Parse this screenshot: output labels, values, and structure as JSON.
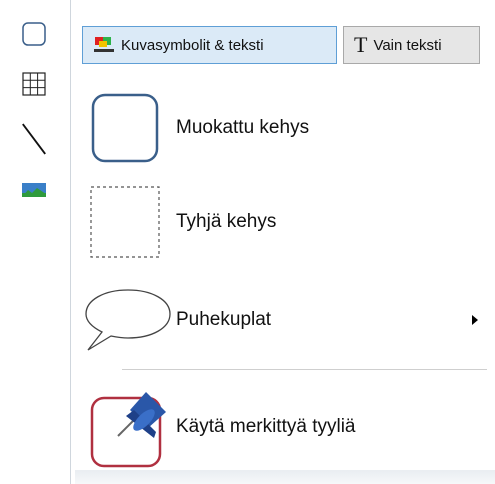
{
  "toolbar_left": {
    "tools": [
      {
        "icon": "rounded-frame-icon"
      },
      {
        "icon": "table-grid-icon"
      },
      {
        "icon": "line-icon"
      },
      {
        "icon": "picture-icon"
      }
    ]
  },
  "mode_buttons": {
    "symbols_text": "Kuvasymbolit & teksti",
    "text_only": "Vain teksti"
  },
  "menu": {
    "custom_frame": "Muokattu kehys",
    "empty_frame": "Tyhjä kehys",
    "speech_bubbles": "Puhekuplat",
    "use_marked_style": "Käytä merkittyä tyyliä"
  },
  "colors": {
    "active_button_bg": "#dbeaf7",
    "active_button_border": "#5f9fd6",
    "frame_border_blue": "#3a5f8a",
    "marked_style_border": "#b03040",
    "pin_blue": "#2a57a8"
  }
}
